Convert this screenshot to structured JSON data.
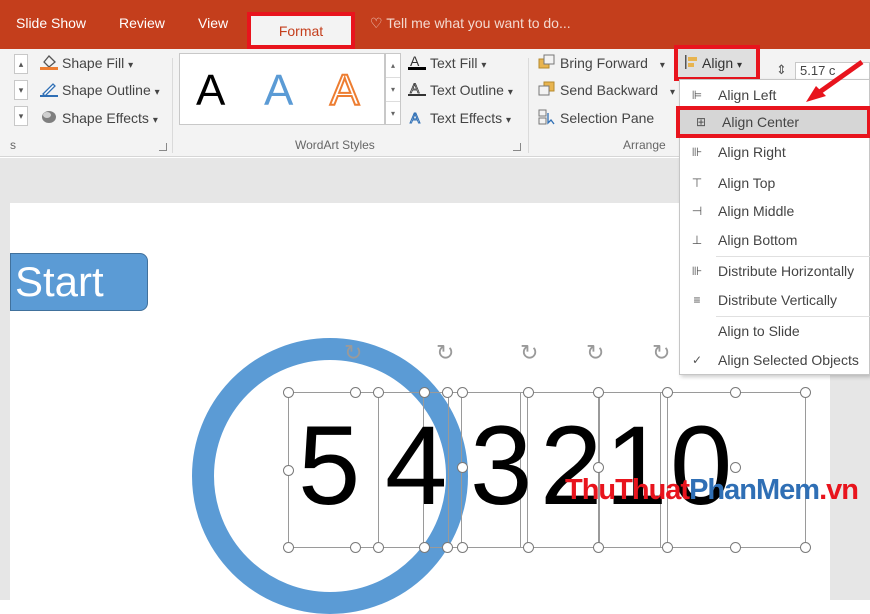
{
  "tabs": {
    "slide_show": "Slide Show",
    "review": "Review",
    "view": "View",
    "format": "Format",
    "tell_me": "Tell me what you want to do..."
  },
  "ribbon": {
    "shape_fill": "Shape Fill",
    "shape_outline": "Shape Outline",
    "shape_effects": "Shape Effects",
    "wordart_letter": "A",
    "text_fill": "Text Fill",
    "text_outline": "Text Outline",
    "text_effects": "Text Effects",
    "bring_forward": "Bring Forward",
    "send_backward": "Send Backward",
    "selection_pane": "Selection Pane",
    "align": "Align",
    "size_value": "5.17 c",
    "group_partial": "s",
    "group_wordart": "WordArt Styles",
    "group_arrange": "Arrange",
    "dropdown_arrow": "▾"
  },
  "align_menu": {
    "items": [
      {
        "label": "Align Left",
        "icon": "align-left-icon",
        "glyph": "⊫"
      },
      {
        "label": "Align Center",
        "icon": "align-center-icon",
        "glyph": "⊞"
      },
      {
        "label": "Align Right",
        "icon": "align-right-icon",
        "glyph": "⊪"
      },
      {
        "label": "Align Top",
        "icon": "align-top-icon",
        "glyph": "⊤"
      },
      {
        "label": "Align Middle",
        "icon": "align-middle-icon",
        "glyph": "⊣"
      },
      {
        "label": "Align Bottom",
        "icon": "align-bottom-icon",
        "glyph": "⊥"
      },
      {
        "label": "Distribute Horizontally",
        "icon": "distribute-horizontally-icon",
        "glyph": "⊪"
      },
      {
        "label": "Distribute Vertically",
        "icon": "distribute-vertically-icon",
        "glyph": "≡"
      },
      {
        "label": "Align to Slide",
        "icon": "",
        "glyph": ""
      },
      {
        "label": "Align Selected Objects",
        "icon": "checkmark-icon",
        "glyph": "✓"
      }
    ],
    "active_item": "Align Center"
  },
  "slide": {
    "start_label": "Start",
    "digits": [
      "5",
      "4",
      "3",
      "2",
      "1",
      "0"
    ]
  },
  "watermark": {
    "part1": "ThuThuat",
    "part2": "PhanMem",
    "part3": ".vn"
  },
  "colors": {
    "tab_bar": "#c43e1c",
    "highlight_border": "#e8141d",
    "shape_blue": "#5b9bd5",
    "wordart_blue": "#5b9bd5",
    "wordart_orange": "#ed7d31"
  }
}
